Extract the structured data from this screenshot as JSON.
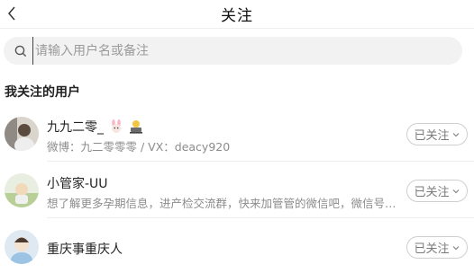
{
  "header": {
    "title": "关注"
  },
  "search": {
    "placeholder": "请输入用户名或备注"
  },
  "section": {
    "title": "我关注的用户"
  },
  "users": [
    {
      "name": "九九二零_",
      "subtitle": "微博：九二零零零 / VX：deacy920",
      "follow_label": "已关注",
      "has_emojis": true
    },
    {
      "name": "小管家-UU",
      "subtitle": "想了解更多孕期信息，进产检交流群，快来加管管的微信吧，微信号…",
      "follow_label": "已关注"
    },
    {
      "name": "重庆事重庆人",
      "subtitle": "",
      "follow_label": "已关注"
    }
  ],
  "icons": {
    "back": "chevron-left-icon",
    "search": "search-icon",
    "dropdown": "chevron-down-icon"
  }
}
